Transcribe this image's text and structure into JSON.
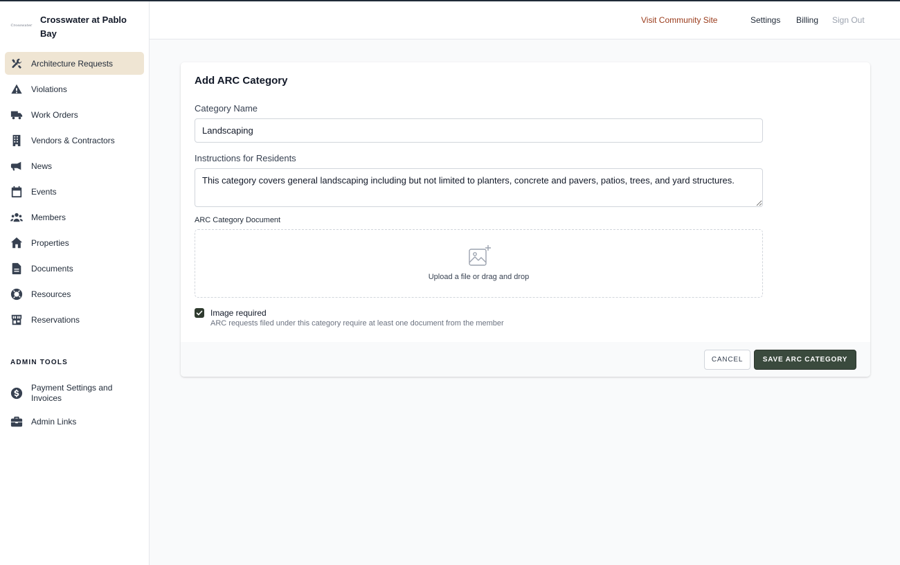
{
  "brand": {
    "name": "Crosswater at Pablo Bay",
    "logo_text": "Crosswater"
  },
  "sidebar": {
    "items": [
      {
        "label": "Architecture Requests",
        "icon": "tools-icon",
        "active": true
      },
      {
        "label": "Violations",
        "icon": "warning-icon"
      },
      {
        "label": "Work Orders",
        "icon": "truck-icon"
      },
      {
        "label": "Vendors & Contractors",
        "icon": "building-icon"
      },
      {
        "label": "News",
        "icon": "megaphone-icon"
      },
      {
        "label": "Events",
        "icon": "calendar-icon"
      },
      {
        "label": "Members",
        "icon": "users-icon"
      },
      {
        "label": "Properties",
        "icon": "home-icon"
      },
      {
        "label": "Documents",
        "icon": "document-icon"
      },
      {
        "label": "Resources",
        "icon": "lifebuoy-icon"
      },
      {
        "label": "Reservations",
        "icon": "store-icon"
      }
    ],
    "admin_heading": "ADMIN TOOLS",
    "admin_items": [
      {
        "label": "Payment Settings and Invoices",
        "icon": "dollar-icon"
      },
      {
        "label": "Admin Links",
        "icon": "briefcase-icon"
      }
    ]
  },
  "topbar": {
    "visit_site": "Visit Community Site",
    "settings": "Settings",
    "billing": "Billing",
    "sign_out": "Sign Out"
  },
  "form": {
    "title": "Add ARC Category",
    "category_name_label": "Category Name",
    "category_name_value": "Landscaping",
    "instructions_label": "Instructions for Residents",
    "instructions_value": "This category covers general landscaping including but not limited to planters, concrete and pavers, patios, trees, and yard structures.",
    "document_label": "ARC Category Document",
    "upload_text": "Upload a file or drag and drop",
    "image_required_label": "Image required",
    "image_required_checked": true,
    "image_required_help": "ARC requests filed under this category require at least one document from the member",
    "cancel_label": "CANCEL",
    "save_label": "SAVE ARC CATEGORY"
  },
  "colors": {
    "active_nav_bg": "#efe5d3",
    "visit_link": "#9a3b1b",
    "primary_button": "#3a4a3d",
    "sign_out": "#9ca3af"
  }
}
